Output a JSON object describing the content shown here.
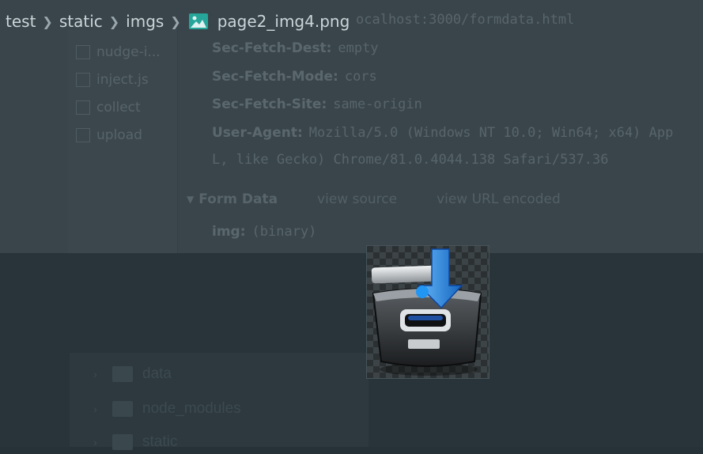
{
  "breadcrumb": {
    "items": [
      "test",
      "static",
      "imgs",
      "page2_img4.png"
    ],
    "file_icon": "image-file-icon"
  },
  "background_screenshot": {
    "sidebar_files": [
      "nudge-i...",
      "inject.js",
      "collect",
      "upload"
    ],
    "headers": [
      {
        "key": "",
        "value": "ocalhost:3000/formdata.html"
      },
      {
        "key": "Sec-Fetch-Dest:",
        "value": "empty"
      },
      {
        "key": "Sec-Fetch-Mode:",
        "value": "cors"
      },
      {
        "key": "Sec-Fetch-Site:",
        "value": "same-origin"
      },
      {
        "key": "User-Agent:",
        "value": "Mozilla/5.0 (Windows NT 10.0; Win64; x64) App"
      },
      {
        "key": "",
        "value": "L, like Gecko) Chrome/81.0.4044.138 Safari/537.36"
      }
    ],
    "form_data": {
      "title": "Form Data",
      "view_source": "view source",
      "view_url_encoded": "view URL encoded",
      "field_key": "img:",
      "field_value": "(binary)"
    },
    "explorer_items": [
      "data",
      "node_modules",
      "static"
    ]
  },
  "preview": {
    "icon": "archive-box-download-icon",
    "accent_color": "#26c6da",
    "arrow_color": "#1e88e5"
  }
}
